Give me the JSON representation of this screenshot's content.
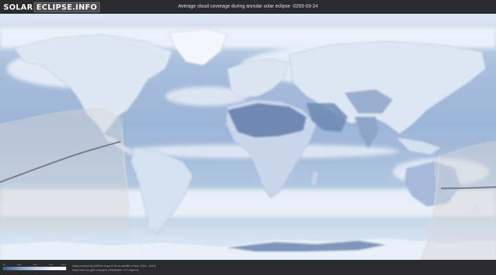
{
  "header": {
    "logo_part1": "SOLAR",
    "logo_part2": "ECLIPSE.INFO",
    "title": "Average cloud coverage during annular solar eclipse -0255-03-24"
  },
  "legend": {
    "scale_labels": [
      "0%",
      "25%",
      "50%",
      "75%",
      "100%"
    ],
    "gradient_colors": [
      "#3c5f8d",
      "#7d9bc2",
      "#b8cde3",
      "#e8f0f8",
      "#ffffff"
    ]
  },
  "footer": {
    "credit_line1": "Data provided by NASA's Aqua & Terra satellite (Years: 2000 - 2019)",
    "credit_line2": "https://neo.sci.gsfc.nasa.gov  |  Resolution: 0.1 degrees"
  },
  "map": {
    "ocean_color": "#8fa9cc",
    "cloud_color": "#eef3fa",
    "land_clear_color": "#5e7aa8",
    "eclipse_path_color": "#6c7480",
    "visibility_overlay_color": "#d9d9d9"
  }
}
